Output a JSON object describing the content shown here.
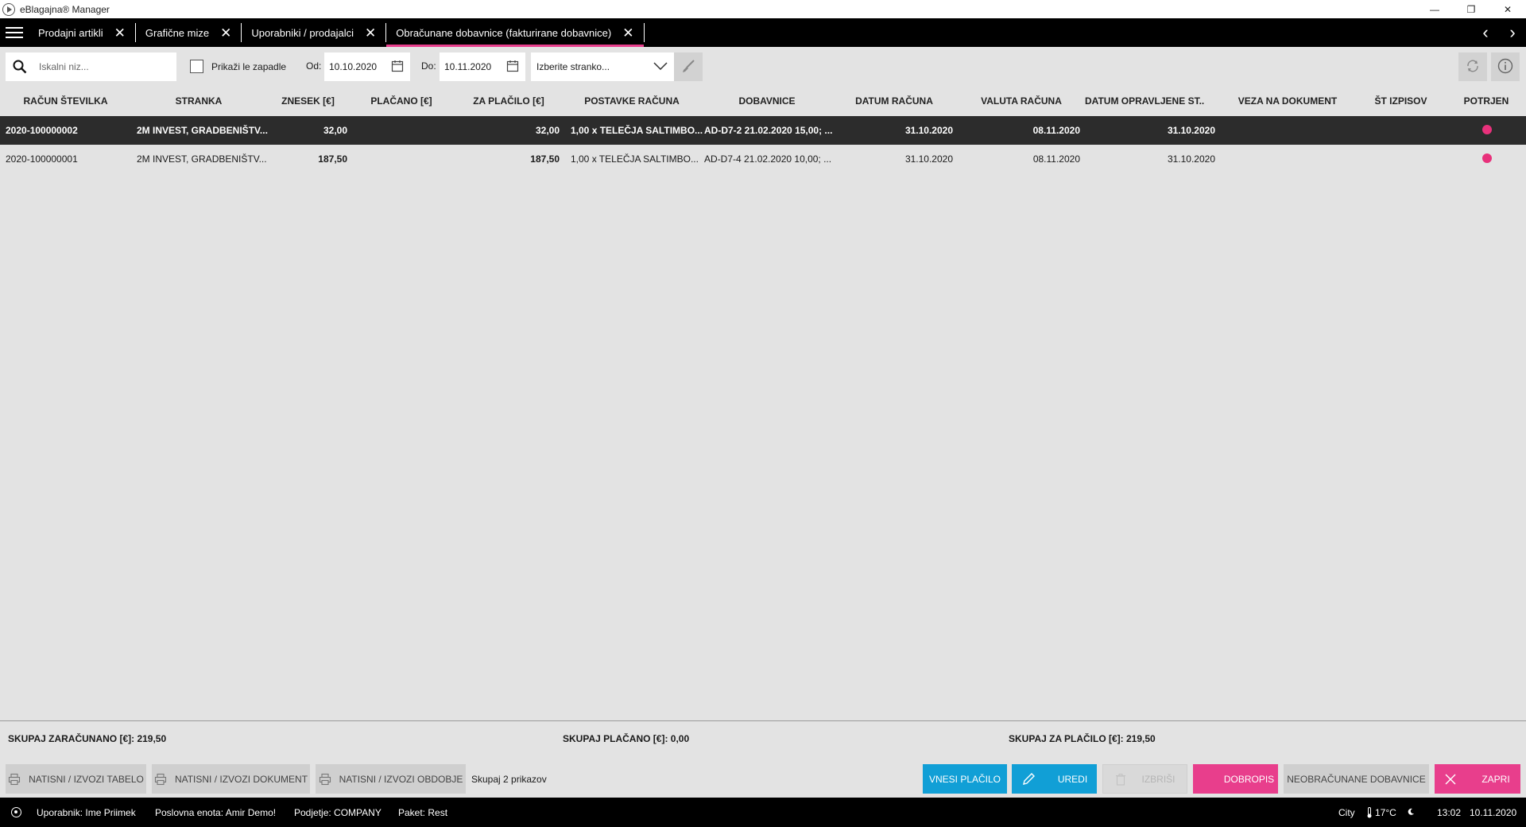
{
  "window": {
    "title": "eBlagajna® Manager",
    "minimize": "—",
    "restore": "❐",
    "close": "✕"
  },
  "tabs": [
    {
      "label": "Prodajni artikli"
    },
    {
      "label": "Grafične mize"
    },
    {
      "label": "Uporabniki / prodajalci"
    },
    {
      "label": "Obračunane dobavnice (fakturirane dobavnice)"
    }
  ],
  "tab_close": "✕",
  "tab_nav": {
    "prev": "‹",
    "next": "›"
  },
  "filters": {
    "search_placeholder": "Iskalni niz...",
    "overdue_label": "Prikaži le zapadle",
    "from_label": "Od:",
    "from_date": "10.10.2020",
    "to_label": "Do:",
    "to_date": "10.11.2020",
    "customer_placeholder": "Izberite stranko..."
  },
  "table": {
    "columns": [
      "RAČUN ŠTEVILKA",
      "STRANKA",
      "ZNESEK [€]",
      "PLAČANO [€]",
      "ZA PLAČILO [€]",
      "POSTAVKE RAČUNA",
      "DOBAVNICE",
      "DATUM RAČUNA",
      "VALUTA RAČUNA",
      "DATUM OPRAVLJENE ST...",
      "VEZA NA DOKUMENT",
      "ŠT IZPISOV",
      "POTRJEN"
    ],
    "rows": [
      {
        "number": "2020-100000002",
        "customer": "2M INVEST, GRADBENIŠTV...",
        "amount": "32,00",
        "paid": "",
        "to_pay": "32,00",
        "items": "1,00 x TELEČJA SALTIMBO...",
        "delivery_notes": "AD-D7-2 21.02.2020 15,00; ...",
        "invoice_date": "31.10.2020",
        "due_date": "08.11.2020",
        "service_date": "31.10.2020",
        "link": "",
        "prints": "",
        "confirmed": true,
        "selected": true
      },
      {
        "number": "2020-100000001",
        "customer": "2M INVEST, GRADBENIŠTV...",
        "amount": "187,50",
        "paid": "",
        "to_pay": "187,50",
        "items": "1,00 x TELEČJA SALTIMBO...",
        "delivery_notes": "AD-D7-4 21.02.2020 10,00; ...",
        "invoice_date": "31.10.2020",
        "due_date": "08.11.2020",
        "service_date": "31.10.2020",
        "link": "",
        "prints": "",
        "confirmed": true,
        "selected": false
      }
    ]
  },
  "totals": {
    "invoiced": "SKUPAJ ZARAČUNANO [€]: 219,50",
    "paid": "SKUPAJ PLAČANO [€]: 0,00",
    "to_pay": "SKUPAJ ZA PLAČILO [€]: 219,50"
  },
  "actions": {
    "print_table": "NATISNI / IZVOZI TABELO",
    "print_document": "NATISNI / IZVOZI DOKUMENT",
    "print_period": "NATISNI / IZVOZI OBDOBJE",
    "count": "Skupaj 2 prikazov",
    "enter_payment": "VNESI PLAČILO",
    "edit": "UREDI",
    "delete": "IZBRIŠI",
    "credit_note": "DOBROPIS",
    "uninvoiced": "NEOBRAČUNANE DOBAVNICE",
    "close": "ZAPRI"
  },
  "statusbar": {
    "user": "Uporabnik: Ime Priimek",
    "unit": "Poslovna enota: Amir Demo!",
    "company": "Podjetje: COMPANY",
    "package": "Paket: Rest",
    "city": "City",
    "temperature": "17°C",
    "time": "13:02",
    "date": "10.11.2020"
  },
  "colors": {
    "accent_pink": "#e83e8c",
    "accent_blue": "#119fd6",
    "confirmed_dot": "#e8317b"
  }
}
